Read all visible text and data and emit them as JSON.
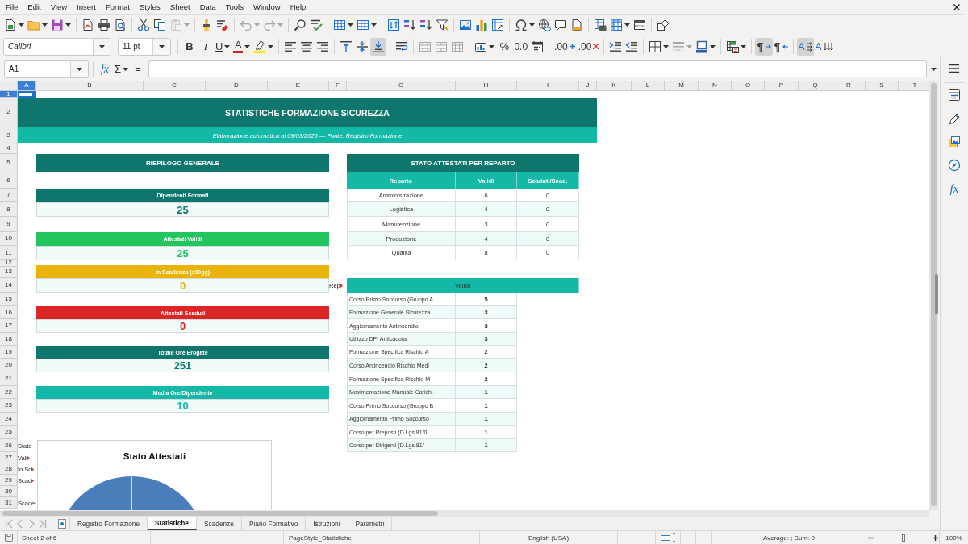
{
  "menu": [
    "File",
    "Edit",
    "View",
    "Insert",
    "Format",
    "Styles",
    "Sheet",
    "Data",
    "Tools",
    "Window",
    "Help"
  ],
  "standard_toolbar": [
    {
      "kind": "new",
      "disabled": false
    },
    {
      "kind": "open",
      "disabled": false
    },
    {
      "kind": "save",
      "disabled": false
    },
    {
      "kind": "export_pdf",
      "disabled": false
    },
    {
      "kind": "print",
      "disabled": false
    },
    {
      "kind": "print_preview",
      "disabled": false
    },
    {
      "kind": "cut",
      "disabled": false
    },
    {
      "kind": "copy",
      "disabled": false
    },
    {
      "kind": "paste",
      "disabled": true
    },
    {
      "kind": "clone_formatting",
      "disabled": false
    },
    {
      "kind": "clear_formatting",
      "disabled": false
    },
    {
      "kind": "undo",
      "disabled": true
    },
    {
      "kind": "redo",
      "disabled": true
    },
    {
      "kind": "find_replace",
      "disabled": false
    },
    {
      "kind": "spelling",
      "disabled": false
    },
    {
      "kind": "row",
      "disabled": false
    },
    {
      "kind": "column",
      "disabled": false
    },
    {
      "kind": "sort",
      "disabled": false
    },
    {
      "kind": "sort_ascending",
      "disabled": false
    },
    {
      "kind": "sort_descending",
      "disabled": false
    },
    {
      "kind": "autofilter",
      "disabled": false
    },
    {
      "kind": "image",
      "disabled": false
    },
    {
      "kind": "chart",
      "disabled": false
    },
    {
      "kind": "pivot_table",
      "disabled": false
    },
    {
      "kind": "special_character",
      "disabled": false
    },
    {
      "kind": "hyperlink",
      "disabled": false
    },
    {
      "kind": "comment",
      "disabled": false
    },
    {
      "kind": "headers_footers",
      "disabled": false
    },
    {
      "kind": "print_area",
      "disabled": false
    },
    {
      "kind": "freeze",
      "disabled": false
    },
    {
      "kind": "split_window",
      "disabled": false
    },
    {
      "kind": "draw_functions",
      "disabled": false
    }
  ],
  "format_toolbar": {
    "font_name": "Calibri",
    "font_size": "11 pt",
    "buttons": [
      {
        "kind": "bold",
        "label": "B",
        "on": false,
        "disabled": false
      },
      {
        "kind": "italic",
        "label": "I",
        "on": false,
        "disabled": false
      },
      {
        "kind": "underline",
        "label": "U",
        "on": false,
        "disabled": false
      },
      {
        "kind": "font_color",
        "label": "A",
        "on": false,
        "disabled": false
      },
      {
        "kind": "highlight",
        "on": false,
        "disabled": false
      },
      {
        "kind": "align_left",
        "on": false,
        "disabled": false
      },
      {
        "kind": "align_center",
        "on": false,
        "disabled": false
      },
      {
        "kind": "align_right",
        "on": false,
        "disabled": false
      },
      {
        "kind": "align_top",
        "on": false,
        "disabled": false
      },
      {
        "kind": "align_middle",
        "on": false,
        "disabled": false
      },
      {
        "kind": "align_bottom",
        "on": true,
        "disabled": false
      },
      {
        "kind": "wrap",
        "on": false,
        "disabled": false
      },
      {
        "kind": "merge_center",
        "on": false,
        "disabled": true
      },
      {
        "kind": "merge",
        "on": false,
        "disabled": true
      },
      {
        "kind": "unmerge",
        "on": false,
        "disabled": true
      },
      {
        "kind": "currency",
        "on": false,
        "disabled": false
      },
      {
        "kind": "percent",
        "label": "%",
        "on": false,
        "disabled": false
      },
      {
        "kind": "number",
        "label": "0.0",
        "on": false,
        "disabled": false
      },
      {
        "kind": "date",
        "on": false,
        "disabled": false
      },
      {
        "kind": "add_decimal",
        "label": ".00",
        "on": false,
        "disabled": false
      },
      {
        "kind": "delete_decimal",
        "label": ".00",
        "on": false,
        "disabled": false
      },
      {
        "kind": "indent_more",
        "on": false,
        "disabled": false
      },
      {
        "kind": "indent_less",
        "on": false,
        "disabled": false
      },
      {
        "kind": "borders",
        "on": false,
        "disabled": false
      },
      {
        "kind": "border_style",
        "on": false,
        "disabled": true
      },
      {
        "kind": "border_color",
        "on": false,
        "disabled": false
      },
      {
        "kind": "conditional",
        "on": false,
        "disabled": false
      },
      {
        "kind": "ltr",
        "label": "¶",
        "on": true,
        "disabled": false
      },
      {
        "kind": "rtl",
        "label": "¶",
        "on": false,
        "disabled": false
      },
      {
        "kind": "text_ltr",
        "label": "A",
        "on": true,
        "disabled": false
      },
      {
        "kind": "text_ttb",
        "label": "A",
        "on": false,
        "disabled": false
      }
    ]
  },
  "formula_bar": {
    "name_box": "A1",
    "function_wizard": "fx",
    "sum": "Σ",
    "equals": "="
  },
  "columns": [
    {
      "label": "A",
      "selected": true
    },
    {
      "label": "B",
      "selected": false
    },
    {
      "label": "C",
      "selected": false
    },
    {
      "label": "D",
      "selected": false
    },
    {
      "label": "E",
      "selected": false
    },
    {
      "label": "F",
      "selected": false
    },
    {
      "label": "G",
      "selected": false
    },
    {
      "label": "H",
      "selected": false
    },
    {
      "label": "I",
      "selected": false
    },
    {
      "label": "J",
      "selected": false
    },
    {
      "label": "K",
      "selected": false
    },
    {
      "label": "L",
      "selected": false
    },
    {
      "label": "M",
      "selected": false
    },
    {
      "label": "N",
      "selected": false
    },
    {
      "label": "O",
      "selected": false
    },
    {
      "label": "P",
      "selected": false
    },
    {
      "label": "Q",
      "selected": false
    },
    {
      "label": "R",
      "selected": false
    },
    {
      "label": "S",
      "selected": false
    },
    {
      "label": "T",
      "selected": false
    }
  ],
  "rows": [
    {
      "label": "1",
      "selected": true
    },
    {
      "label": "2",
      "selected": false
    },
    {
      "label": "3",
      "selected": false
    },
    {
      "label": "4",
      "selected": false
    },
    {
      "label": "5",
      "selected": false
    },
    {
      "label": "6",
      "selected": false
    },
    {
      "label": "7",
      "selected": false
    },
    {
      "label": "8",
      "selected": false
    },
    {
      "label": "9",
      "selected": false
    },
    {
      "label": "10",
      "selected": false
    },
    {
      "label": "11",
      "selected": false
    },
    {
      "label": "12",
      "selected": false
    },
    {
      "label": "13",
      "selected": false
    },
    {
      "label": "14",
      "selected": false
    },
    {
      "label": "15",
      "selected": false
    },
    {
      "label": "16",
      "selected": false
    },
    {
      "label": "17",
      "selected": false
    },
    {
      "label": "18",
      "selected": false
    },
    {
      "label": "19",
      "selected": false
    },
    {
      "label": "20",
      "selected": false
    },
    {
      "label": "21",
      "selected": false
    },
    {
      "label": "22",
      "selected": false
    },
    {
      "label": "23",
      "selected": false
    },
    {
      "label": "24",
      "selected": false
    },
    {
      "label": "25",
      "selected": false
    },
    {
      "label": "26",
      "selected": false
    },
    {
      "label": "27",
      "selected": false
    },
    {
      "label": "28",
      "selected": false
    },
    {
      "label": "29",
      "selected": false
    },
    {
      "label": "30",
      "selected": false
    },
    {
      "label": "31",
      "selected": false
    }
  ],
  "sheet": {
    "title": "STATISTICHE FORMAZIONE SICUREZZA",
    "subtitle": "Elaborazione automatica al 09/03/2026 — Fonte: Registro Formazione",
    "summary": {
      "title": "RIEPILOGO GENERALE",
      "kpis": [
        {
          "label": "Dipendenti Formati",
          "value": "25",
          "color": "#0f766e"
        },
        {
          "label": "Attestati Validi",
          "value": "25",
          "color": "#22c55e"
        },
        {
          "label": "In Scadenza (≤90gg)",
          "value": "0",
          "color": "#eab308"
        },
        {
          "label": "Attestati Scaduti",
          "value": "0",
          "color": "#dc2626"
        },
        {
          "label": "Totale Ore Erogate",
          "value": "251",
          "color": "#0f766e"
        },
        {
          "label": "Media Ore/Dipendente",
          "value": "10",
          "color": "#14b8a6"
        }
      ]
    },
    "department_table": {
      "title": "STATO ATTESTATI PER REPARTO",
      "columns": [
        "Reparto",
        "Validi",
        "Scaduti/Scad."
      ],
      "rows": [
        [
          "Amministrazione",
          "6",
          "0"
        ],
        [
          "Logistica",
          "4",
          "0"
        ],
        [
          "Manutenzione",
          "3",
          "0"
        ],
        [
          "Produzione",
          "4",
          "0"
        ],
        [
          "Qualità",
          "8",
          "0"
        ]
      ]
    },
    "course_table": {
      "side_label": {
        "text": "Rep",
        "clipped": true
      },
      "header": "Validi",
      "rows": [
        [
          "Corso Primo Soccorso (Gruppo A",
          "5"
        ],
        [
          "Formazione Generale Sicurezza",
          "3"
        ],
        [
          "Aggiornamento Antincendio",
          "3"
        ],
        [
          "Utilizzo DPI Anticaduta",
          "3"
        ],
        [
          "Formazione Specifica Rischio A",
          "2"
        ],
        [
          "Corso Antincendio Rischio Medi",
          "2"
        ],
        [
          "Formazione Specifica Rischio M",
          "2"
        ],
        [
          "Movimentazione Manuale Carichi",
          "1"
        ],
        [
          "Corso Primo Soccorso (Gruppo B",
          "1"
        ],
        [
          "Aggiornamento Primo Soccorso",
          "1"
        ],
        [
          "Corso per Preposti (D.Lgs.81/0",
          "1"
        ],
        [
          "Corso per Dirigenti (D.Lgs.81/",
          "1"
        ]
      ]
    },
    "column_a_labels": [
      {
        "text": "Stato",
        "clipped": false
      },
      {
        "text": "Vali",
        "clipped": true
      },
      {
        "text": "In Sc",
        "clipped": true
      },
      {
        "text": "Scad",
        "clipped": true
      },
      {
        "text": "Scade",
        "clipped": true
      }
    ],
    "chart": {
      "title": "Stato Attestati"
    }
  },
  "sheet_nav": [
    {
      "kind": "first",
      "disabled": true
    },
    {
      "kind": "previous",
      "disabled": true
    },
    {
      "kind": "next",
      "disabled": true
    },
    {
      "kind": "last",
      "disabled": true
    }
  ],
  "sheet_tabs": [
    {
      "label": "Registro Formazione",
      "selected": false
    },
    {
      "label": "Statistiche",
      "selected": true
    },
    {
      "label": "Scadenze",
      "selected": false
    },
    {
      "label": "Piano Formativo",
      "selected": false
    },
    {
      "label": "Istruzioni",
      "selected": false
    },
    {
      "label": "Parametri",
      "selected": false
    }
  ],
  "sidebar": [
    {
      "kind": "properties",
      "selected": false
    },
    {
      "kind": "styles",
      "selected": false
    },
    {
      "kind": "gallery",
      "selected": false
    },
    {
      "kind": "navigator",
      "selected": false
    },
    {
      "kind": "functions",
      "label": "fx",
      "selected": false
    }
  ],
  "status_bar": {
    "sheet_position": "Sheet 2 of 6",
    "page_style": "PageStyle_Statistiche",
    "language": "English (USA)",
    "selection_summary": "Average: ; Sum: 0",
    "zoom": {
      "label": "100%",
      "level": 0.5
    }
  }
}
